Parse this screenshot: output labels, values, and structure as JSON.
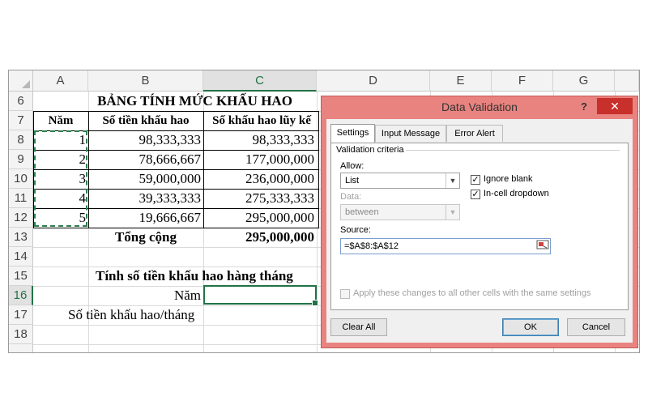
{
  "sheet": {
    "columns": [
      "A",
      "B",
      "C",
      "D",
      "E",
      "F",
      "G"
    ],
    "rows": [
      "6",
      "7",
      "8",
      "9",
      "10",
      "11",
      "12",
      "13",
      "14",
      "15",
      "16",
      "17",
      "18"
    ],
    "title": "BẢNG TÍNH MỨC KHẤU HAO",
    "headers": {
      "nam": "Năm",
      "so_tien": "Số tiền khấu hao",
      "luy_ke": "Số khấu hao lũy kế"
    },
    "data": [
      {
        "nam": "1",
        "so_tien": "98,333,333",
        "luy_ke": "98,333,333"
      },
      {
        "nam": "2",
        "so_tien": "78,666,667",
        "luy_ke": "177,000,000"
      },
      {
        "nam": "3",
        "so_tien": "59,000,000",
        "luy_ke": "236,000,000"
      },
      {
        "nam": "4",
        "so_tien": "39,333,333",
        "luy_ke": "275,333,333"
      },
      {
        "nam": "5",
        "so_tien": "19,666,667",
        "luy_ke": "295,000,000"
      }
    ],
    "total_label": "Tổng cộng",
    "total_value": "295,000,000",
    "monthly_title": "Tính số tiền khấu hao hàng tháng",
    "nam_label": "Năm",
    "monthly_label": "Số tiền khấu hao/tháng"
  },
  "dialog": {
    "title": "Data Validation",
    "help": "?",
    "close": "✕",
    "tabs": [
      "Settings",
      "Input Message",
      "Error Alert"
    ],
    "criteria_label": "Validation criteria",
    "allow_label": "Allow:",
    "allow_value": "List",
    "ignore_blank_label": "Ignore blank",
    "ignore_blank": true,
    "in_cell_dropdown_label": "In-cell dropdown",
    "in_cell_dropdown": true,
    "data_label": "Data:",
    "data_value": "between",
    "source_label": "Source:",
    "source_value": "=$A$8:$A$12",
    "apply_all_label": "Apply these changes to all other cells with the same settings",
    "apply_all": false,
    "clear_all": "Clear All",
    "ok": "OK",
    "cancel": "Cancel"
  },
  "colors": {
    "excel_green": "#217346",
    "dialog_border": "#e9837f",
    "close_red": "#c8302c"
  }
}
